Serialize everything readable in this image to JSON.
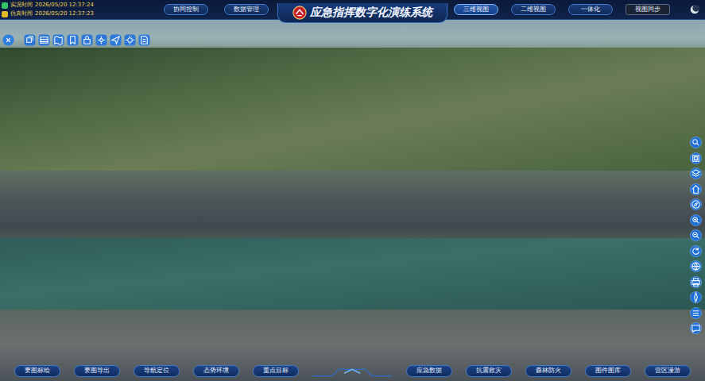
{
  "top_bar": {
    "times": [
      {
        "label": "实况时间",
        "value": "2026/05/20 12:37:24",
        "color": "#35c46a"
      },
      {
        "label": "仿真时间",
        "value": "2026/05/20 12:37:23",
        "color": "#e0b72a"
      }
    ],
    "left_buttons": [
      {
        "label": "协同控制",
        "selected": false
      },
      {
        "label": "数据管理",
        "selected": false
      }
    ],
    "title": "应急指挥数字化演练系统",
    "right_buttons": [
      {
        "label": "三维视图",
        "selected": true
      },
      {
        "label": "二维视图",
        "selected": false
      },
      {
        "label": "一体化",
        "selected": false
      }
    ],
    "sync_button": {
      "label": "视图同步"
    }
  },
  "bottom_bar": [
    {
      "label": "要图标绘",
      "selected": false
    },
    {
      "label": "要图导出",
      "selected": false
    },
    {
      "label": "导航定位",
      "selected": false
    },
    {
      "label": "态势环境",
      "selected": false
    },
    {
      "label": "重点目标",
      "selected": false
    },
    {
      "label": "应急数据",
      "selected": false
    },
    {
      "label": "抗震救灾",
      "selected": false
    },
    {
      "label": "森林防火",
      "selected": false
    },
    {
      "label": "图件图库",
      "selected": false
    },
    {
      "label": "营区漫游",
      "selected": false
    }
  ]
}
